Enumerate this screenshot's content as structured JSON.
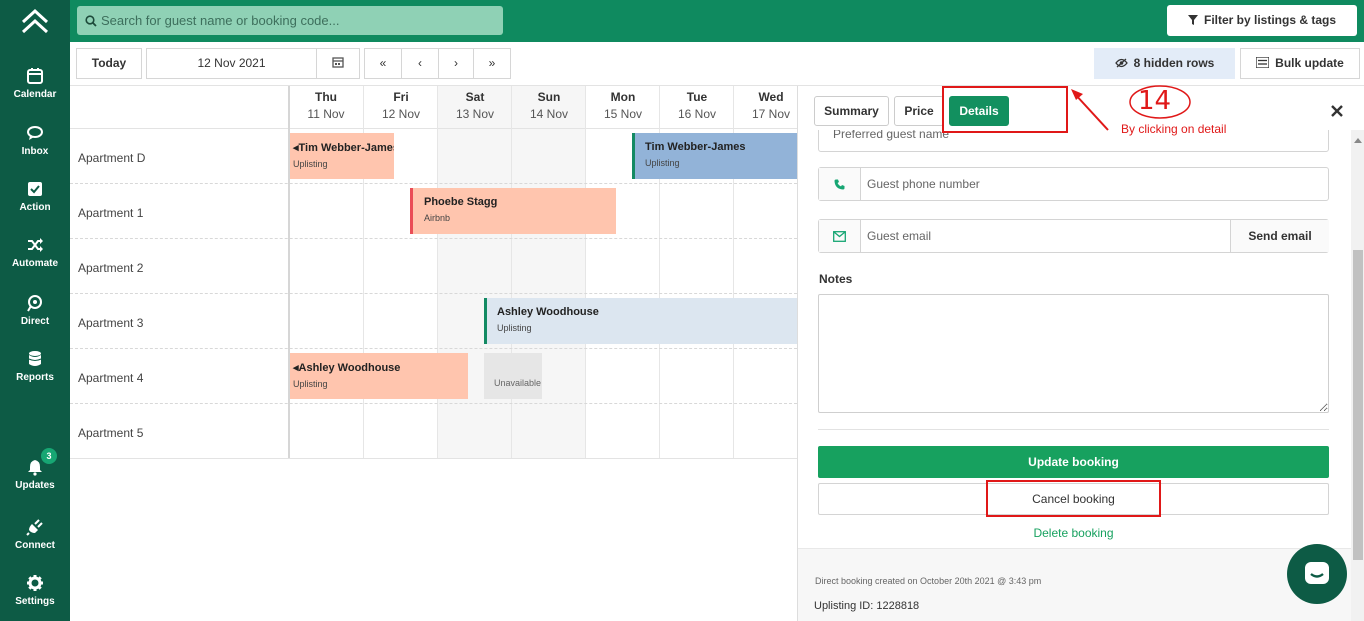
{
  "colors": {
    "sidebar": "#0d5b45",
    "topbar": "#0f8a5f",
    "accent": "#17a673",
    "annotation": "#e01818"
  },
  "sidebar": {
    "logo": "logo-icon",
    "items": [
      {
        "label": "Calendar",
        "icon": "calendar-icon"
      },
      {
        "label": "Inbox",
        "icon": "chat-icon"
      },
      {
        "label": "Action",
        "icon": "checkbox-icon"
      },
      {
        "label": "Automate",
        "icon": "shuffle-icon"
      },
      {
        "label": "Direct",
        "icon": "direct-icon"
      },
      {
        "label": "Reports",
        "icon": "database-icon"
      },
      {
        "label": "Updates",
        "icon": "bell-icon",
        "badge": "3"
      },
      {
        "label": "Connect",
        "icon": "plug-icon"
      },
      {
        "label": "Settings",
        "icon": "gear-icon"
      }
    ]
  },
  "topbar": {
    "search_placeholder": "Search for guest name or booking code...",
    "filter_label": "Filter by listings & tags"
  },
  "toolbar": {
    "today_label": "Today",
    "date_value": "12 Nov 2021",
    "nav": [
      "«",
      "‹",
      "›",
      "»"
    ],
    "hidden_rows_label": "8 hidden rows",
    "bulk_update_label": "Bulk update"
  },
  "calendar": {
    "days": [
      {
        "name": "Thu",
        "date": "11 Nov"
      },
      {
        "name": "Fri",
        "date": "12 Nov"
      },
      {
        "name": "Sat",
        "date": "13 Nov"
      },
      {
        "name": "Sun",
        "date": "14 Nov"
      },
      {
        "name": "Mon",
        "date": "15 Nov"
      },
      {
        "name": "Tue",
        "date": "16 Nov"
      },
      {
        "name": "Wed",
        "date": "17 Nov"
      }
    ],
    "rows": [
      "Apartment D",
      "Apartment 1",
      "Apartment 2",
      "Apartment 3",
      "Apartment 4",
      "Apartment 5"
    ],
    "bookings": [
      {
        "name": "Tim Webber-James",
        "source": "Uplisting"
      },
      {
        "name": "Tim Webber-James",
        "source": "Uplisting"
      },
      {
        "name": "Phoebe Stagg",
        "source": "Airbnb"
      },
      {
        "name": "Ashley Woodhouse",
        "source": "Uplisting"
      },
      {
        "name": "Ashley Woodhouse",
        "source": "Uplisting"
      },
      {
        "name": "",
        "source": "Unavailable"
      }
    ]
  },
  "panel": {
    "tabs": [
      "Summary",
      "Price",
      "Details"
    ],
    "active_tab": "Details",
    "preferred_name_placeholder": "Preferred guest name",
    "phone_placeholder": "Guest phone number",
    "email_placeholder": "Guest email",
    "send_email_label": "Send email",
    "notes_label": "Notes",
    "update_label": "Update booking",
    "cancel_label": "Cancel booking",
    "delete_label": "Delete booking",
    "created_text": "Direct booking created on October 20th 2021 @ 3:43 pm",
    "uplisting_id": "Uplisting ID: 1228818"
  },
  "annotation": {
    "number": "14",
    "text": "By clicking on detail"
  }
}
